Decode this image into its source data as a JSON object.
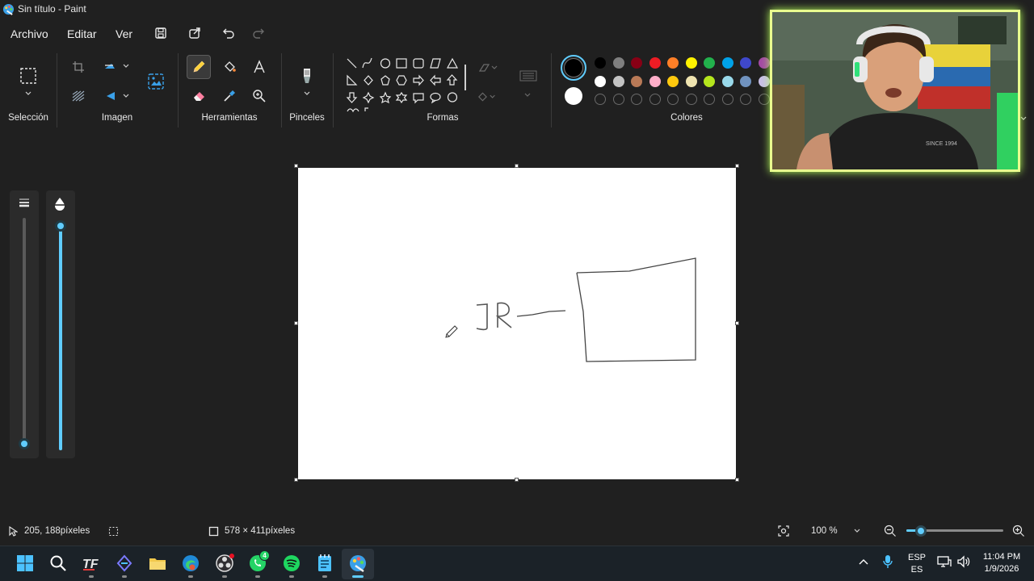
{
  "window": {
    "title": "Sin título - Paint"
  },
  "menu": {
    "file": "Archivo",
    "edit": "Editar",
    "view": "Ver"
  },
  "ribbon": {
    "groups": {
      "selection": "Selección",
      "image": "Imagen",
      "tools": "Herramientas",
      "brushes": "Pinceles",
      "shapes": "Formas",
      "colors": "Colores"
    }
  },
  "colors": {
    "primary": "#000000",
    "secondary": "#ffffff",
    "palette_row1": [
      "#000000",
      "#7f7f7f",
      "#880015",
      "#ed1c24",
      "#ff7f27",
      "#fff200",
      "#22b14c",
      "#00a2e8",
      "#3f48cc",
      "#a349a4"
    ],
    "palette_row2": [
      "#ffffff",
      "#c3c3c3",
      "#b97a57",
      "#ffaec9",
      "#ffc90e",
      "#efe4b0",
      "#b5e61d",
      "#99d9ea",
      "#7092be",
      "#c8bfe7"
    ],
    "accent": "#60cdff"
  },
  "canvas": {
    "handwritten_text": "JR"
  },
  "status": {
    "cursor_position": "205, 188píxeles",
    "canvas_size": "578 × 411píxeles",
    "zoom": "100 %",
    "zoom_slider_fraction": 0.15,
    "size_slider_fraction": 0.0,
    "opacity_slider_fraction": 1.0
  },
  "taskbar": {
    "whatsapp_badge": "4",
    "lang_top": "ESP",
    "lang_bottom": "ES",
    "time": "11:04 PM",
    "date": "1/9/2026"
  },
  "icons": {
    "app_logo": "paint-icon",
    "save": "save-icon",
    "share": "share-icon",
    "undo": "undo-icon",
    "redo": "redo-icon"
  }
}
